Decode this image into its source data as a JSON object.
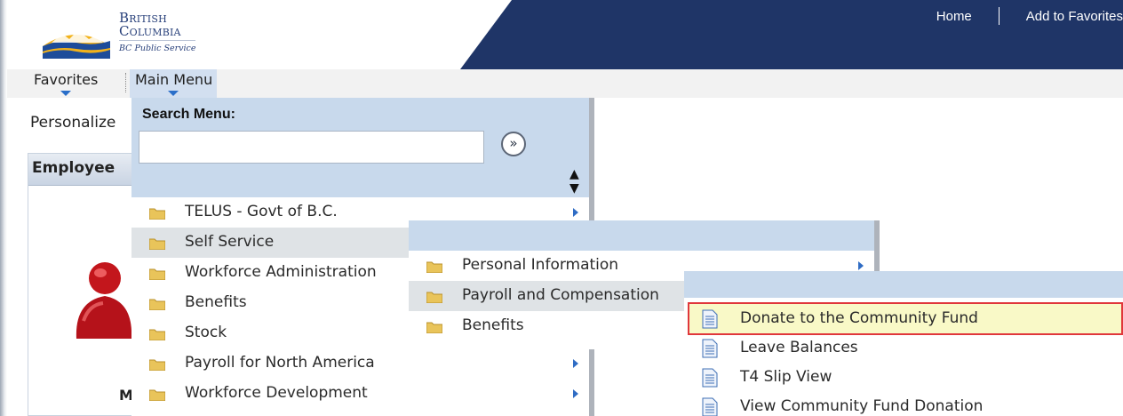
{
  "header": {
    "brand_line1": "British",
    "brand_line2": "Columbia",
    "brand_line3": "BC Public Service",
    "links": [
      "Home",
      "Add to Favorites"
    ]
  },
  "menubar": {
    "favorites_label": "Favorites",
    "main_menu_label": "Main Menu"
  },
  "page": {
    "personalize_label": "Personalize",
    "employee_panel_title": "Employee",
    "me_label": "Me"
  },
  "main_menu": {
    "search_label": "Search Menu:",
    "search_value": "",
    "go_icon": "double-chevron-right-icon",
    "sort_icon": "sort-updown-icon",
    "items": [
      {
        "label": "TELUS - Govt of B.C.",
        "has_submenu": true
      },
      {
        "label": "Self Service",
        "has_submenu": true,
        "selected": true
      },
      {
        "label": "Workforce Administration",
        "has_submenu": true
      },
      {
        "label": "Benefits",
        "has_submenu": true
      },
      {
        "label": "Stock",
        "has_submenu": true
      },
      {
        "label": "Payroll for North America",
        "has_submenu": true
      },
      {
        "label": "Workforce Development",
        "has_submenu": true
      }
    ]
  },
  "self_service_menu": {
    "items": [
      {
        "label": "Personal Information",
        "has_submenu": true
      },
      {
        "label": "Payroll and Compensation",
        "has_submenu": true,
        "selected": true
      },
      {
        "label": "Benefits",
        "has_submenu": true
      }
    ]
  },
  "payroll_menu": {
    "items": [
      {
        "label": "Donate to the Community Fund",
        "highlighted": true
      },
      {
        "label": "Leave Balances"
      },
      {
        "label": "T4 Slip View"
      },
      {
        "label": "View Community Fund Donation"
      }
    ]
  },
  "colors": {
    "navy": "#1f3567",
    "menu_panel": "#c8d9ec",
    "highlight_fill": "#f9f9c7",
    "highlight_border": "#e0373b",
    "arrow": "#2f6cc4",
    "folder": "#e9c45a"
  }
}
